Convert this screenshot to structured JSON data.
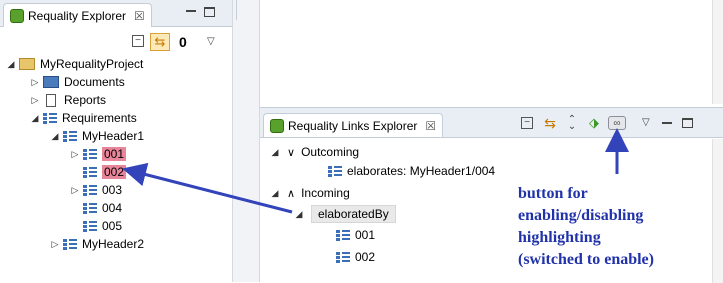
{
  "explorer": {
    "tab_title": "Requality Explorer",
    "tab_close": "☒",
    "counter": "0",
    "tree": {
      "project": "MyRequalityProject",
      "documents": "Documents",
      "reports": "Reports",
      "requirements": "Requirements",
      "header1": "MyHeader1",
      "items": [
        "001",
        "002",
        "003",
        "004",
        "005"
      ],
      "header2": "MyHeader2"
    }
  },
  "links_explorer": {
    "tab_title": "Requality Links Explorer",
    "tab_close": "☒",
    "outcoming_label": "Outcoming",
    "outcoming_item": "elaborates: MyHeader1/004",
    "incoming_label": "Incoming",
    "incoming_group": "elaboratedBy",
    "incoming_items": [
      "001",
      "002"
    ]
  },
  "annotation": {
    "lines": [
      "button for",
      "enabling/disabling",
      "highlighting",
      "(switched to enable)"
    ]
  },
  "colors": {
    "highlight": "#e8859a",
    "arrow": "#3344bb",
    "panel_header": "#e9eef5"
  }
}
